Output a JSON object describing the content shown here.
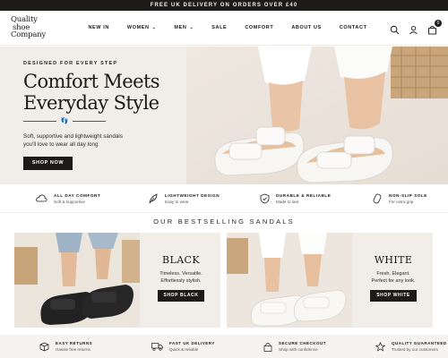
{
  "announcement": "FREE UK DELIVERY ON ORDERS OVER £40",
  "logo": {
    "line1": "Quality",
    "line2": "shoe",
    "line3": "Company"
  },
  "nav": [
    {
      "label": "NEW IN",
      "dropdown": false
    },
    {
      "label": "WOMEN",
      "dropdown": true
    },
    {
      "label": "MEN",
      "dropdown": true
    },
    {
      "label": "SALE",
      "dropdown": false
    },
    {
      "label": "COMFORT",
      "dropdown": false
    },
    {
      "label": "ABOUT US",
      "dropdown": false
    },
    {
      "label": "CONTACT",
      "dropdown": false
    }
  ],
  "header_icons": {
    "search": "search-icon",
    "account": "user-icon",
    "cart": "cart-icon",
    "cart_count": "0"
  },
  "hero": {
    "eyebrow": "DESIGNED FOR EVERY STEP",
    "title_line1": "Comfort Meets",
    "title_line2": "Everyday Style",
    "subtitle": "Soft, supportive and lightweight sandals you'll love to wear all day long",
    "button": "SHOP NOW"
  },
  "features": [
    {
      "icon": "cloud-icon",
      "title": "ALL DAY COMFORT",
      "sub": "Soft & supportive"
    },
    {
      "icon": "feather-icon",
      "title": "LIGHTWEIGHT DESIGN",
      "sub": "Easy to wear"
    },
    {
      "icon": "shield-check-icon",
      "title": "DURABLE & RELIABLE",
      "sub": "Made to last"
    },
    {
      "icon": "sole-icon",
      "title": "NON-SLIP SOLE",
      "sub": "For extra grip"
    }
  ],
  "bestsellers": {
    "heading": "OUR BESTSELLING SANDALS",
    "cards": [
      {
        "name": "BLACK",
        "desc1": "Timeless. Versatile.",
        "desc2": "Effortlessly stylish.",
        "button": "SHOP BLACK"
      },
      {
        "name": "WHITE",
        "desc1": "Fresh. Elegant.",
        "desc2": "Perfect for any look.",
        "button": "SHOP WHITE"
      }
    ]
  },
  "usps": [
    {
      "icon": "box-icon",
      "title": "EASY RETURNS",
      "sub": "Hassle free returns"
    },
    {
      "icon": "truck-icon",
      "title": "FAST UK DELIVERY",
      "sub": "Quick & reliable"
    },
    {
      "icon": "lock-icon",
      "title": "SECURE CHECKOUT",
      "sub": "Shop with confidence"
    },
    {
      "icon": "star-icon",
      "title": "QUALITY GUARANTEED",
      "sub": "Trusted by our customers"
    }
  ],
  "colors": {
    "dark": "#1d1b19",
    "beige": "#f1ede8",
    "accent_text": "#1c1a18"
  }
}
